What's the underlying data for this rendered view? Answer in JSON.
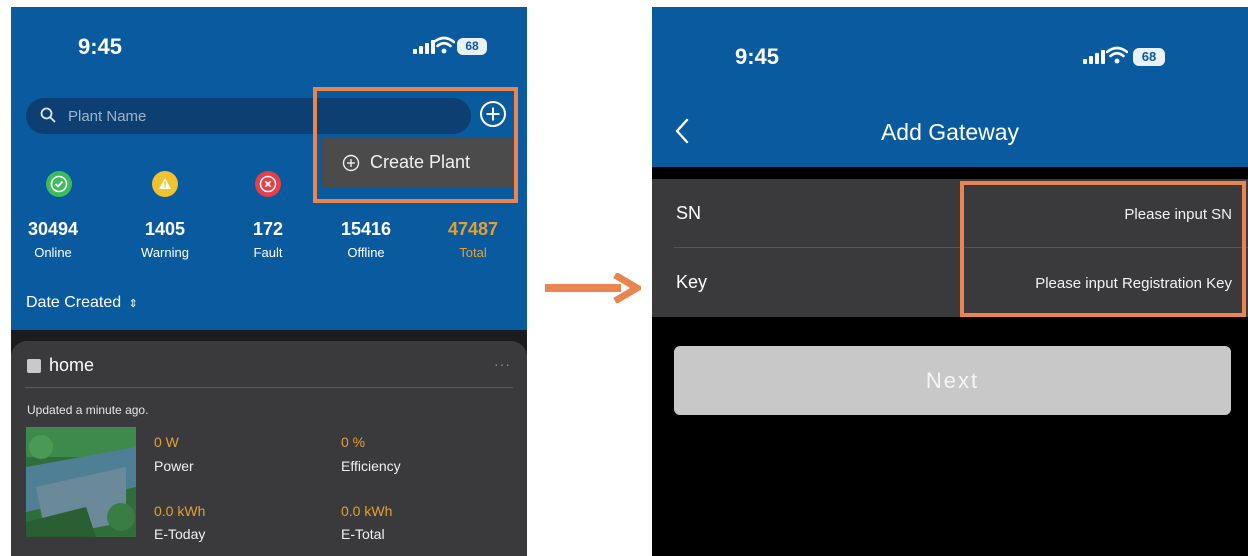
{
  "left_screen": {
    "status_time": "9:45",
    "battery": "68",
    "search": {
      "placeholder": "Plant Name"
    },
    "create_menu_label": "Create Plant",
    "stats": [
      {
        "value": "30494",
        "label": "Online",
        "icon": "check-icon",
        "color": "#3dbb5d"
      },
      {
        "value": "1405",
        "label": "Warning",
        "icon": "warning-icon",
        "color": "#f3c22f"
      },
      {
        "value": "172",
        "label": "Fault",
        "icon": "error-icon",
        "color": "#e5404a"
      },
      {
        "value": "15416",
        "label": "Offline",
        "icon": "offline-icon",
        "color": "#9aa7b5"
      },
      {
        "value": "47487",
        "label": "Total",
        "icon": "total-icon",
        "color": "#e3a032"
      }
    ],
    "sort_label": "Date Created",
    "sort_glyph": "⇕",
    "plant_card": {
      "name": "home",
      "more": "···",
      "updated": "Updated a minute ago.",
      "metrics": [
        {
          "value": "0 W",
          "label": "Power"
        },
        {
          "value": "0 %",
          "label": "Efficiency"
        },
        {
          "value": "0.0 kWh",
          "label": "E-Today"
        },
        {
          "value": "0.0 kWh",
          "label": "E-Total"
        }
      ]
    }
  },
  "right_screen": {
    "status_time": "9:45",
    "battery": "68",
    "title": "Add Gateway",
    "fields": [
      {
        "label": "SN",
        "placeholder": "Please input SN"
      },
      {
        "label": "Key",
        "placeholder": "Please input Registration Key"
      }
    ],
    "next_label": "Next"
  },
  "colors": {
    "app_blue": "#0a5aa0",
    "highlight": "#ea8552",
    "accent_orange": "#e3a032"
  }
}
